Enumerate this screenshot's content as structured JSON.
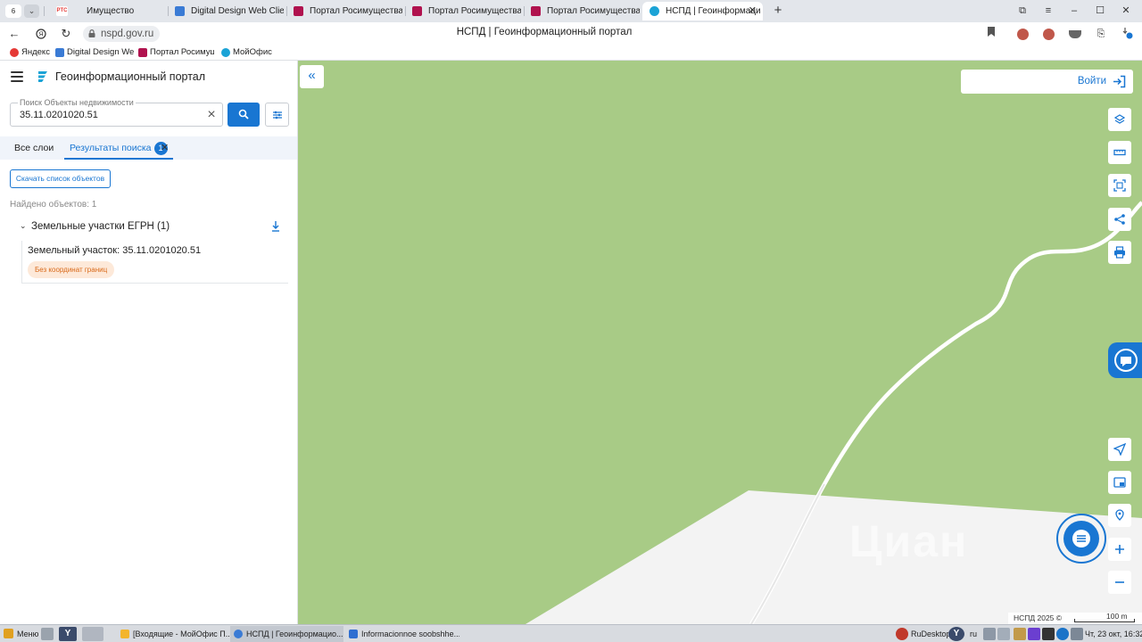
{
  "browser": {
    "tab_counter": "6",
    "tabs": [
      {
        "label": "Имущество",
        "favicon": "rts-icon",
        "favicon_text": "РТС",
        "color": "#e53935"
      },
      {
        "label": "Digital Design Web Client",
        "favicon": "dd-icon",
        "color": "#3a7bd5"
      },
      {
        "label": "Портал Росимущества",
        "favicon": "rosim-icon",
        "color": "#b0124e"
      },
      {
        "label": "Портал Росимущества",
        "favicon": "rosim-icon",
        "color": "#b0124e"
      },
      {
        "label": "Портал Росимущества",
        "favicon": "rosim-icon",
        "color": "#b0124e"
      },
      {
        "label": "НСПД | Геоинформаци",
        "favicon": "nspd-icon",
        "color": "#1ba3d6",
        "active": true
      }
    ],
    "url": "nspd.gov.ru",
    "page_title": "НСПД | Геоинформационный портал",
    "bookmarks": [
      {
        "label": "Яндекс",
        "color": "#e53935"
      },
      {
        "label": "Digital Design We",
        "color": "#3a7bd5"
      },
      {
        "label": "Портал Росимущ",
        "color": "#b0124e"
      },
      {
        "label": "МойОфис",
        "color": "#1ba3d6"
      }
    ]
  },
  "panel": {
    "app_title": "Геоинформационный портал",
    "search": {
      "label": "Поиск Объекты недвижимости",
      "value": "35.11.0201020.51"
    },
    "tabs": {
      "all_layers": "Все слои",
      "results": "Результаты поиска",
      "results_count": "1"
    },
    "download_list_label": "Скачать список объектов",
    "found_text": "Найдено объектов: 1",
    "group": {
      "title": "Земельные участки ЕГРН (1)",
      "items": [
        {
          "title": "Земельный участок: 35.11.0201020.51",
          "badge": "Без координат границ"
        }
      ]
    }
  },
  "map": {
    "login_label": "Войти",
    "watermark": "Циан",
    "attribution": "НСПД 2025 ©",
    "scale_label": "100 m",
    "colors": {
      "forest": "#a8cb86",
      "open_area": "#f3f3f3",
      "accent": "#1976d2"
    },
    "tools": [
      "layers-icon",
      "ruler-icon",
      "select-area-icon",
      "share-icon",
      "print-icon",
      "locate-icon",
      "minimap-icon",
      "geolocation-icon",
      "zoom-in-icon",
      "zoom-out-icon"
    ]
  },
  "taskbar": {
    "menu_label": "Меню",
    "tasks": [
      {
        "label": "[Входящие - МойОфис П...",
        "color": "#f3b52c"
      },
      {
        "label": "НСПД | Геоинформацио...",
        "color": "#3a7bd5",
        "active": true
      },
      {
        "label": "Informacionnoe soobshhe...",
        "color": "#2f6fd1"
      }
    ],
    "tray": {
      "rudesktop": "RuDesktop",
      "lang": "ru",
      "clock": "Чт, 23 окт, 16:32"
    }
  }
}
